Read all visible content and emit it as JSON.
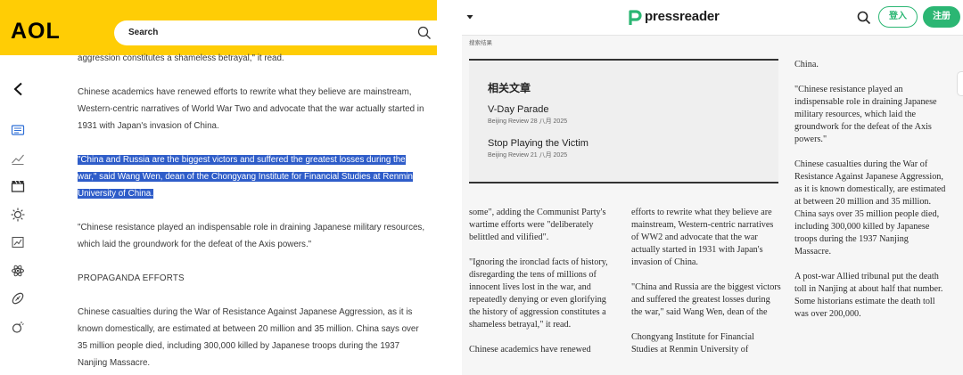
{
  "aol": {
    "logo": "AOL",
    "search": {
      "label": "Search"
    },
    "rail_icons": [
      "newspaper-icon",
      "trending-icon",
      "film-icon",
      "sun-icon",
      "chart-icon",
      "atom-icon",
      "football-icon",
      "weather-icon"
    ],
    "article": {
      "cut_line": "aggression constitutes a shameless betrayal,\" it read.",
      "p1": "Chinese academics have renewed efforts to rewrite what they believe are mainstream, Western-centric narratives of World War Two and advocate that the war actually started in 1931 with Japan's invasion of China.",
      "p2_highlighted": "\"China and Russia are the biggest victors and suffered the greatest losses during the war,\" said Wang Wen, dean of the Chongyang Institute for Financial Studies at Renmin University of China.",
      "p3": "\"Chinese resistance played an indispensable role in draining Japanese military resources, which laid the groundwork for the defeat of the Axis powers.\"",
      "heading": "PROPAGANDA EFFORTS",
      "p4": "Chinese casualties during the War of Resistance Against Japanese Aggression, as it is known domestically, are estimated at between 20 million and 35 million. China says over 35 million people died, including 300,000 killed by Japanese troops during the 1937 Nanjing Massacre."
    }
  },
  "pressreader": {
    "logo": "pressreader",
    "login": "登入",
    "register": "注册",
    "breadcrumb": "搜索结果",
    "related": {
      "title": "相关文章",
      "items": [
        {
          "title": "V-Day Parade",
          "meta": "Beijing Review   28 八月 2025"
        },
        {
          "title": "Stop Playing the Victim",
          "meta": "Beijing Review   21 八月 2025"
        }
      ]
    },
    "col1": [
      "some\", adding the Communist Party's wartime efforts were \"deliberately belittled and vilified\".",
      "\"Ignoring the ironclad facts of history, disregarding the tens of millions of innocent lives lost in the war, and repeatedly denying or even glorifying the history of aggression constitutes a shameless betrayal,\" it read.",
      "Chinese academics have renewed"
    ],
    "col2": [
      "efforts to rewrite what they believe are mainstream, Western-centric narratives of WW2 and advocate that the war actually started in 1931 with Japan's invasion of China.",
      "\"China and Russia are the biggest victors and suffered the greatest losses during the war,\" said Wang Wen, dean of the",
      "Chongyang Institute for Financial Studies at Renmin University of"
    ],
    "col3": [
      "China.",
      "\"Chinese resistance played an indispensable role in draining Japanese military resources, which laid the groundwork for the defeat of the Axis powers.\"",
      "Chinese casualties during the War of Resistance Against Japanese Aggression, as it is known domestically, are estimated at between 20 million and 35 million. China says over 35 million people died, including 300,000 killed by Japanese troops during the 1937 Nanjing Massacre.",
      "A post-war Allied tribunal put the death toll in Nanjing at about half that number. Some historians estimate the death toll was over 200,000."
    ]
  },
  "colors": {
    "aol_yellow": "#ffcd05",
    "highlight": "#2f5dc9",
    "pressreader_green": "#2bb673"
  }
}
